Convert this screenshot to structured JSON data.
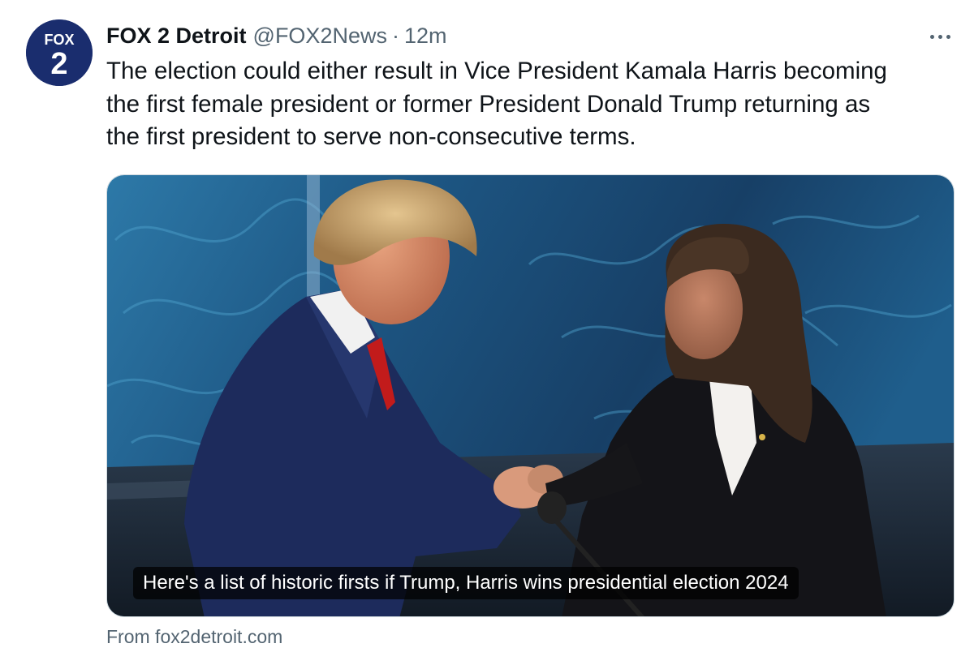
{
  "tweet": {
    "author": {
      "display_name": "FOX 2 Detroit",
      "handle": "@FOX2News",
      "avatar_logo_top": "FOX",
      "avatar_logo_bottom": "2"
    },
    "separator": "·",
    "timestamp": "12m",
    "text": "The election could either result in Vice President Kamala Harris becoming\nthe first female president or former President Donald Trump returning as\nthe first president to serve non-consecutive terms.",
    "card": {
      "caption": "Here's a list of historic firsts if Trump, Harris wins presidential election 2024",
      "source": "From fox2detroit.com"
    }
  },
  "icons": {
    "more": "more-options-icon"
  },
  "colors": {
    "text_primary": "#0f1419",
    "text_secondary": "#536471",
    "border": "#cfd9de",
    "avatar_bg": "#1a2d6e",
    "backdrop_blue": "#1d5a8c"
  }
}
